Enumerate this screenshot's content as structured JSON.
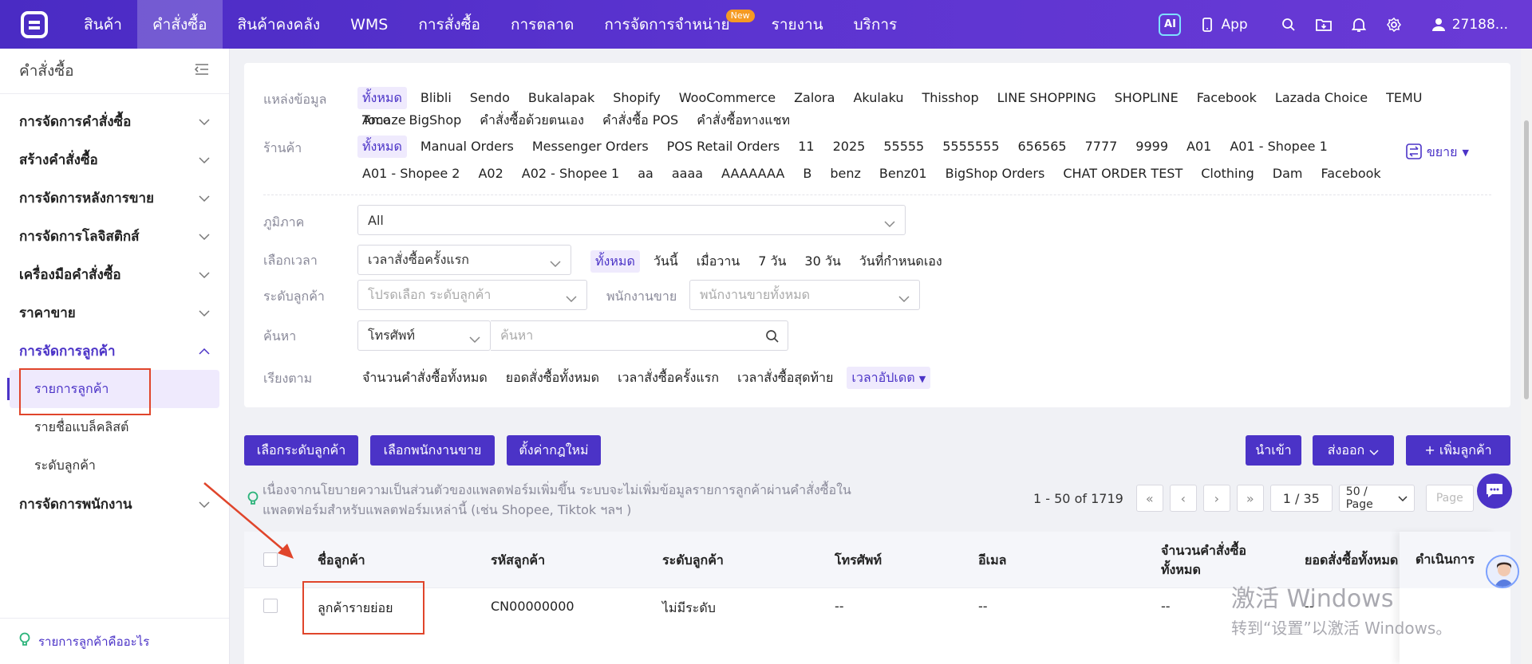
{
  "topnav": {
    "items": [
      "สินค้า",
      "คำสั่งซื้อ",
      "สินค้าคงคลัง",
      "WMS",
      "การสั่งซื้อ",
      "การตลาด",
      "การจัดการจำหน่าย",
      "รายงาน",
      "บริการ"
    ],
    "new_badge": "New",
    "ai_label": "AI",
    "app_label": "App",
    "user_label": "27188..."
  },
  "sidebar": {
    "title": "คำสั่งซื้อ",
    "groups": [
      "การจัดการคำสั่งซื้อ",
      "สร้างคำสั่งซื้อ",
      "การจัดการหลังการขาย",
      "การจัดการโลจิสติกส์",
      "เครื่องมือคำสั่งซื้อ",
      "ราคาขาย",
      "การจัดการลูกค้า"
    ],
    "sub_items": [
      "รายการลูกค้า",
      "รายชื่อแบล็คลิสต์",
      "ระดับลูกค้า"
    ],
    "last_group": "การจัดการพนักงาน",
    "footer_link": "รายการลูกค้าคืออะไร"
  },
  "filters": {
    "source_label": "แหล่งข้อมูล",
    "sources_row1": [
      "ทั้งหมด",
      "Blibli",
      "Sendo",
      "Bukalapak",
      "Shopify",
      "WooCommerce",
      "Zalora",
      "Akulaku",
      "Thisshop",
      "LINE SHOPPING",
      "SHOPLINE",
      "Facebook",
      "Lazada Choice",
      "TEMU",
      "Amaze"
    ],
    "sources_row2": [
      "Toco",
      "BigShop",
      "คำสั่งซื้อด้วยตนเอง",
      "คำสั่งซื้อ POS",
      "คำสั่งซื้อทางแชท"
    ],
    "shop_label": "ร้านค้า",
    "shops_row1": [
      "ทั้งหมด",
      "Manual Orders",
      "Messenger Orders",
      "POS Retail Orders",
      "11",
      "2025",
      "55555",
      "5555555",
      "656565",
      "7777",
      "9999",
      "A01",
      "A01 - Shopee 1"
    ],
    "shops_row2": [
      "A01 - Shopee 2",
      "A02",
      "A02 - Shopee 1",
      "aa",
      "aaaa",
      "AAAAAAA",
      "B",
      "benz",
      "Benz01",
      "BigShop Orders",
      "CHAT ORDER TEST",
      "Clothing",
      "Dam",
      "Facebook"
    ],
    "expand_label": "ขยาย",
    "region_label": "ภูมิภาค",
    "region_value": "All",
    "time_label": "เลือกเวลา",
    "time_type": "เวลาสั่งซื้อครั้งแรก",
    "time_options": [
      "ทั้งหมด",
      "วันนี้",
      "เมื่อวาน",
      "7 วัน",
      "30 วัน",
      "วันที่กำหนดเอง"
    ],
    "level_label": "ระดับลูกค้า",
    "level_placeholder": "โปรดเลือก ระดับลูกค้า",
    "sales_label": "พนักงานขาย",
    "sales_placeholder": "พนักงานขายทั้งหมด",
    "search_label": "ค้นหา",
    "search_type": "โทรศัพท์",
    "search_placeholder": "ค้นหา",
    "sort_label": "เรียงตาม",
    "sort_options": [
      "จำนวนคำสั่งซื้อทั้งหมด",
      "ยอดสั่งซื้อทั้งหมด",
      "เวลาสั่งซื้อครั้งแรก",
      "เวลาสั่งซื้อสุดท้าย",
      "เวลาอัปเดต"
    ]
  },
  "actions": {
    "select_level": "เลือกระดับลูกค้า",
    "select_sales": "เลือกพนักงานขาย",
    "set_rules": "ตั้งค่ากฎใหม่",
    "import": "นำเข้า",
    "export": "ส่งออก",
    "add_customer": "+ เพิ่มลูกค้า"
  },
  "notice": "เนื่องจากนโยบายความเป็นส่วนตัวของแพลตฟอร์มเพิ่มขึ้น ระบบจะไม่เพิ่มข้อมูลรายการลูกค้าผ่านคำสั่งซื้อใน แพลตฟอร์มสำหรับแพลตฟอร์มเหล่านี้ (เช่น Shopee, Tiktok ฯลฯ )",
  "pagination": {
    "range": "1 - 50 of 1719",
    "page": "1 / 35",
    "page_size": "50 / Page",
    "goto_placeholder": "Page"
  },
  "table": {
    "headers": [
      "ชื่อลูกค้า",
      "รหัสลูกค้า",
      "ระดับลูกค้า",
      "โทรศัพท์",
      "อีเมล",
      "จำนวนคำสั่งซื้อทั้งหมด",
      "ยอดสั่งซื้อทั้งหมด",
      "ดำเนินการ"
    ],
    "rows": [
      {
        "name": "ลูกค้ารายย่อย",
        "code": "CN00000000",
        "level": "ไม่มีระดับ",
        "phone": "--",
        "email": "--",
        "orders": "--",
        "amount": "--"
      }
    ]
  },
  "watermark": {
    "line1": "激活 Windows",
    "line2": "转到“设置”以激活 Windows。"
  },
  "colors": {
    "brand": "#4b33c7",
    "highlight": "#e0452b"
  }
}
